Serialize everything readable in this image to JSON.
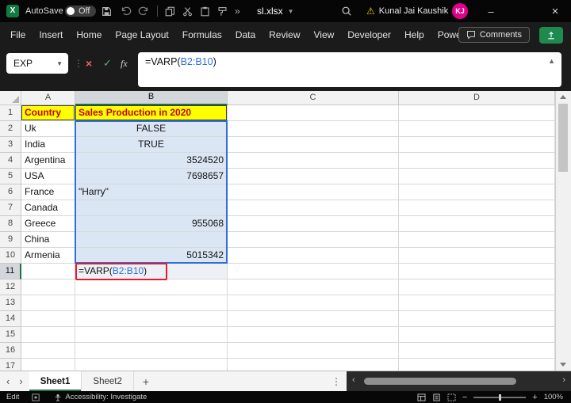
{
  "titlebar": {
    "autosave_label": "AutoSave",
    "autosave_state": "Off",
    "filename": "sl.xlsx",
    "account_name": "Kunal Jai Kaushik",
    "avatar_initials": "KJ"
  },
  "menubar": {
    "items": [
      "File",
      "Insert",
      "Home",
      "Page Layout",
      "Formulas",
      "Data",
      "Review",
      "View",
      "Developer",
      "Help",
      "Power Pivot"
    ],
    "comments_label": "Comments"
  },
  "formula_bar": {
    "name_box_value": "EXP",
    "fx_label": "fx",
    "formula_prefix": "=VARP(",
    "formula_range": "B2:B10",
    "formula_suffix": ")"
  },
  "grid": {
    "column_headers": [
      "A",
      "B",
      "C",
      "D"
    ],
    "total_rows": 17,
    "header_row": {
      "country_label": "Country",
      "sales_label": "Sales Production in 2020"
    },
    "data_rows": [
      {
        "row": 2,
        "country": "Uk",
        "value": "FALSE",
        "align": "center"
      },
      {
        "row": 3,
        "country": "India",
        "value": "TRUE",
        "align": "center"
      },
      {
        "row": 4,
        "country": "Argentina",
        "value": "3524520",
        "align": "right"
      },
      {
        "row": 5,
        "country": "USA",
        "value": "7698657",
        "align": "right"
      },
      {
        "row": 6,
        "country": "France",
        "value": "\"Harry\"",
        "align": "left"
      },
      {
        "row": 7,
        "country": "Canada",
        "value": "",
        "align": "right"
      },
      {
        "row": 8,
        "country": "Greece",
        "value": "955068",
        "align": "right"
      },
      {
        "row": 9,
        "country": "China",
        "value": "",
        "align": "right"
      },
      {
        "row": 10,
        "country": "Armenia",
        "value": "5015342",
        "align": "right"
      }
    ],
    "formula_row": {
      "row": 11,
      "prefix": "=VARP(",
      "range": "B2:B10",
      "suffix": ")"
    }
  },
  "sheet_tabs": {
    "tabs": [
      "Sheet1",
      "Sheet2"
    ],
    "active_tab": "Sheet1",
    "add_button": "+"
  },
  "status_bar": {
    "mode": "Edit",
    "accessibility": "Accessibility: Investigate",
    "zoom_level": "100%"
  },
  "colors": {
    "excel_green": "#107c41",
    "range_border_blue": "#2f6fd6",
    "range_fill_blue": "#dbe6f5",
    "header_fill_yellow": "#ffff00",
    "header_text_red": "#c00000",
    "annotation_red": "#e8192c",
    "avatar_pink": "#e3008c",
    "warning_yellow": "#f2c811"
  }
}
